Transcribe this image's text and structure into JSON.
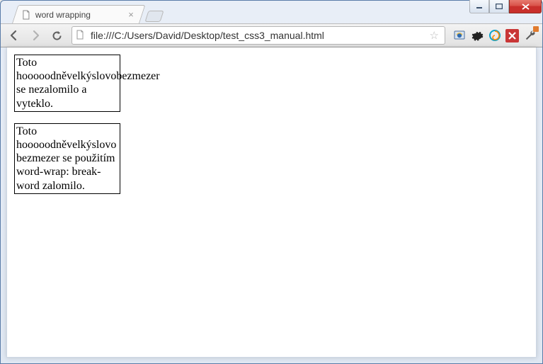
{
  "window": {
    "os": "Windows 7"
  },
  "tabs": [
    {
      "title": "word wrapping",
      "icon": "page"
    }
  ],
  "toolbar": {
    "back": "Back",
    "forward": "Forward",
    "reload": "Reload",
    "url": "file:///C:/Users/David/Desktop/test_css3_manual.html",
    "star": "☆"
  },
  "extensions": [
    {
      "name": "ie-tab",
      "glyph": "🔵",
      "color": "#3b6ea5"
    },
    {
      "name": "settings-gear",
      "glyph": "✲",
      "color": "#222"
    },
    {
      "name": "swirl",
      "glyph": "❂",
      "color": "#0aa2c9"
    },
    {
      "name": "xmarks",
      "glyph": "✖",
      "color": "#fff",
      "bg": "#c33"
    },
    {
      "name": "wrench",
      "glyph": "🔧",
      "color": "#555"
    }
  ],
  "page": {
    "box1": "Toto hooooodněvelkýslovobezmezer se nezalomilo a vyteklo.",
    "box2": "Toto hooooodněvelkýslovobezmezer se použitím word-wrap: break-word zalomilo."
  }
}
